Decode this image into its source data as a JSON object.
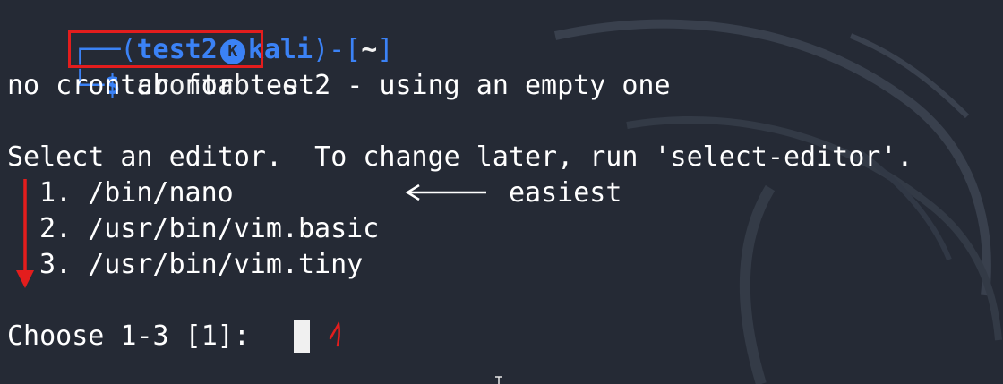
{
  "prompt": {
    "user": "test2",
    "host": "kali",
    "dir": "~",
    "symbol": "$",
    "command": "crontab -e",
    "host_icon_glyph": "K"
  },
  "output": {
    "line1": "no crontab for test2 - using an empty one",
    "line2": "Select an editor.  To change later, run 'select-editor'.",
    "options": [
      {
        "num": "1.",
        "path": "/bin/nano"
      },
      {
        "num": "2.",
        "path": "/usr/bin/vim.basic"
      },
      {
        "num": "3.",
        "path": "/usr/bin/vim.tiny"
      }
    ],
    "annotation_label": "easiest",
    "choose_prompt": "Choose 1-3 [1]: ",
    "handwritten_answer": "1"
  },
  "colors": {
    "background": "#252a35",
    "prompt_accent": "#3b82f6",
    "annotation_red": "#e31d1d"
  }
}
